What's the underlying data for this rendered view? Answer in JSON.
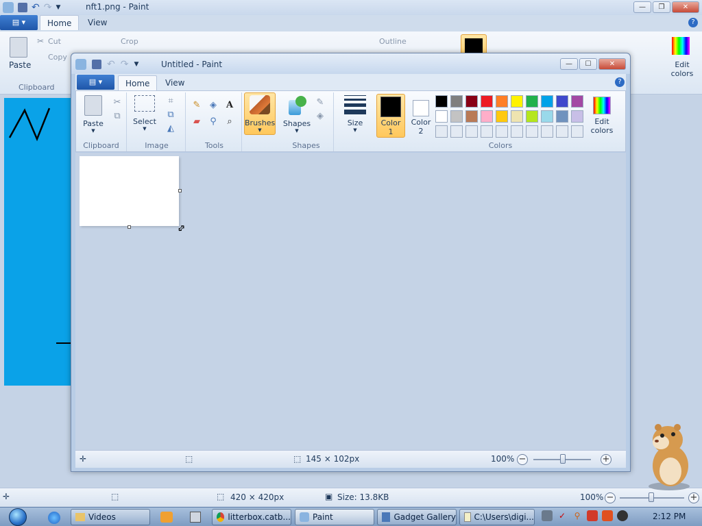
{
  "background_window": {
    "title": "nft1.png - Paint",
    "tabs": [
      "Home",
      "View"
    ],
    "ribbon": {
      "clipboard_label": "Clipboard",
      "paste_label": "Paste",
      "cut_label": "Cut",
      "copy_label": "Copy",
      "crop_label": "Crop",
      "outline_label": "Outline",
      "edit_colors_label": "Edit colors"
    },
    "status": {
      "dimensions": "420 × 420px",
      "size": "Size: 13.8KB",
      "zoom": "100%"
    }
  },
  "front_window": {
    "title": "Untitled - Paint",
    "tabs": [
      "Home",
      "View"
    ],
    "ribbon": {
      "paste_label": "Paste",
      "clipboard_label": "Clipboard",
      "select_label": "Select",
      "image_label": "Image",
      "tools_label": "Tools",
      "brushes_label": "Brushes",
      "shapes_button_label": "Shapes",
      "shapes_group_label": "Shapes",
      "size_label": "Size",
      "color1_label": "Color 1",
      "color2_label": "Color 2",
      "edit_colors_label": "Edit colors",
      "colors_label": "Colors"
    },
    "palette_row1": [
      "#000000",
      "#7f7f7f",
      "#880015",
      "#ed1c24",
      "#ff7f27",
      "#fff200",
      "#22b14c",
      "#00a2e8",
      "#3f48cc",
      "#a349a4"
    ],
    "palette_row2": [
      "#ffffff",
      "#c3c3c3",
      "#b97a57",
      "#ffaec9",
      "#ffc90e",
      "#efe4b0",
      "#b5e61d",
      "#99d9ea",
      "#7092be",
      "#c8bfe7"
    ],
    "color1": "#000000",
    "color2": "#ffffff",
    "status": {
      "selection_size": "145 × 102px",
      "zoom": "100%"
    }
  },
  "taskbar": {
    "items": [
      "Videos",
      "litterbox.catb...",
      "Paint",
      "Gadget Gallery",
      "C:\\Users\\digi..."
    ],
    "clock": "2:12 PM"
  }
}
